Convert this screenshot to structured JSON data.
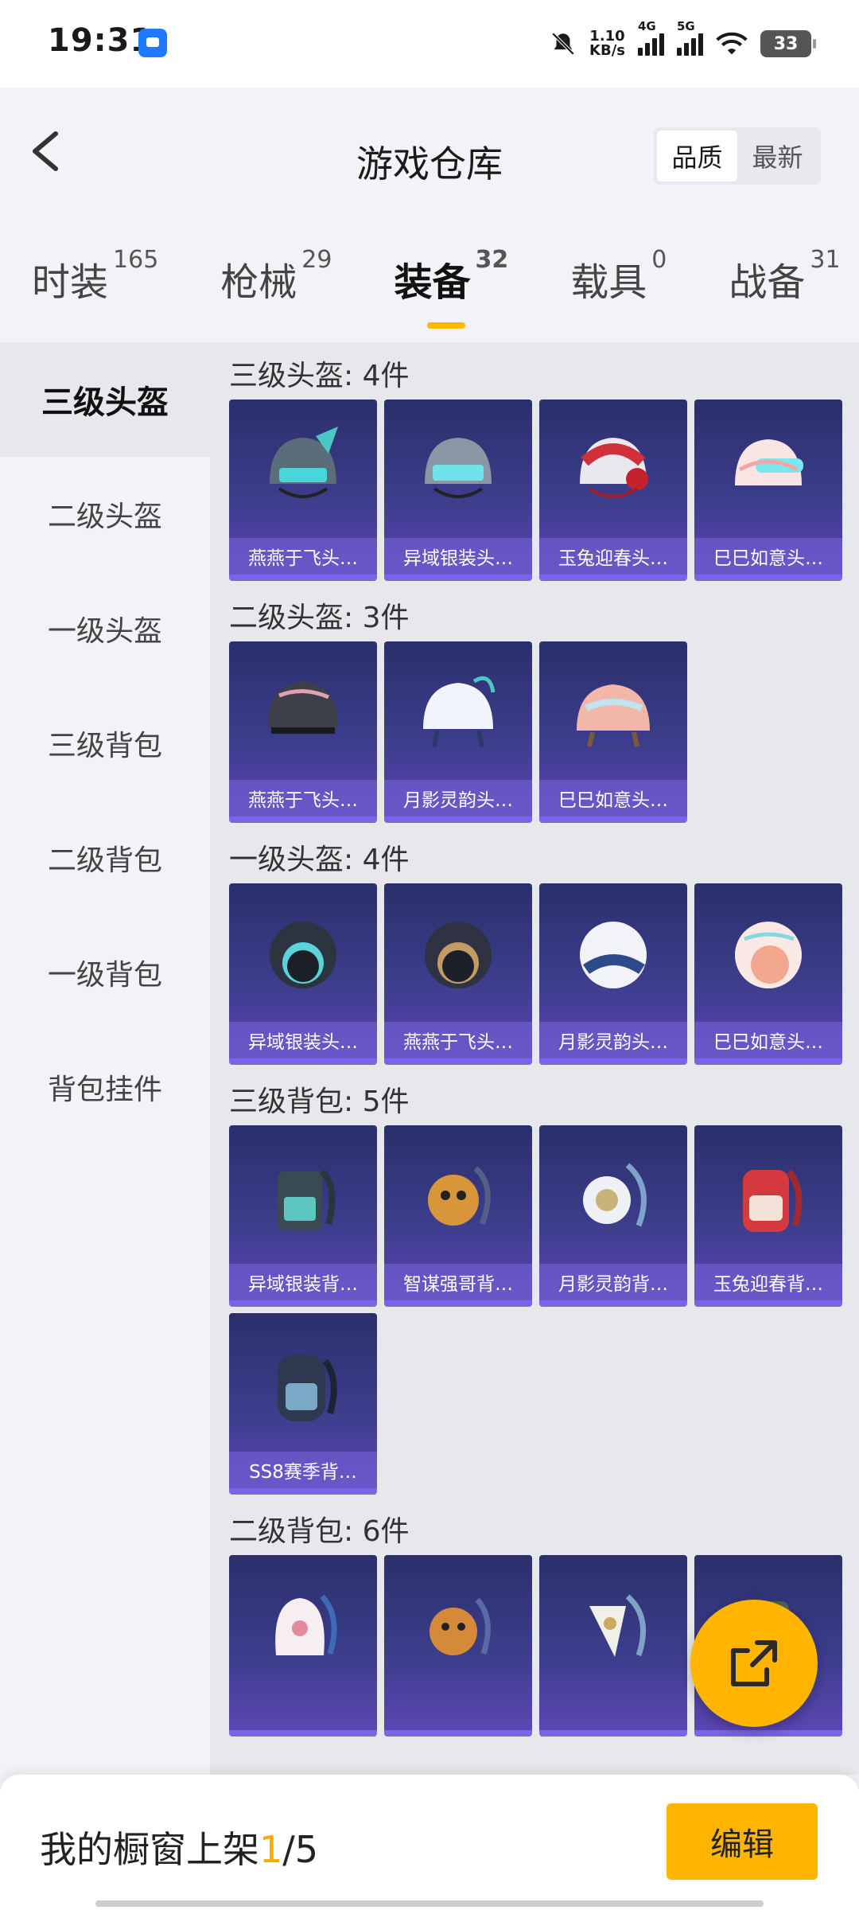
{
  "status": {
    "time": "19:31",
    "net_speed": "1.10",
    "net_unit": "KB/s",
    "sig1": "4G",
    "sig2": "5G",
    "battery": "33"
  },
  "header": {
    "title": "游戏仓库",
    "sort": [
      "品质",
      "最新"
    ]
  },
  "tabs": [
    {
      "label": "时装",
      "count": "165"
    },
    {
      "label": "枪械",
      "count": "29"
    },
    {
      "label": "装备",
      "count": "32"
    },
    {
      "label": "载具",
      "count": "0"
    },
    {
      "label": "战备",
      "count": "31"
    }
  ],
  "sidebar": [
    "三级头盔",
    "二级头盔",
    "一级头盔",
    "三级背包",
    "二级背包",
    "一级背包",
    "背包挂件"
  ],
  "sections": [
    {
      "title": "三级头盔: 4件",
      "items": [
        "燕燕于飞头…",
        "异域银装头…",
        "玉兔迎春头…",
        "巳巳如意头…"
      ]
    },
    {
      "title": "二级头盔: 3件",
      "items": [
        "燕燕于飞头…",
        "月影灵韵头…",
        "巳巳如意头…"
      ]
    },
    {
      "title": "一级头盔: 4件",
      "items": [
        "异域银装头…",
        "燕燕于飞头…",
        "月影灵韵头…",
        "巳巳如意头…"
      ]
    },
    {
      "title": "三级背包: 5件",
      "items": [
        "异域银装背…",
        "智谋强哥背…",
        "月影灵韵背…",
        "玉兔迎春背…",
        "SS8赛季背…"
      ]
    },
    {
      "title": "二级背包: 6件",
      "items": [
        "",
        "",
        "",
        ""
      ]
    }
  ],
  "bottom": {
    "label_prefix": "我的橱窗上架",
    "current": "1",
    "sep_total": "/5",
    "edit": "编辑"
  },
  "colors": {
    "accent": "#ffb400",
    "card_top": "#2b2f6b",
    "card_bottom": "#5b46b3"
  }
}
